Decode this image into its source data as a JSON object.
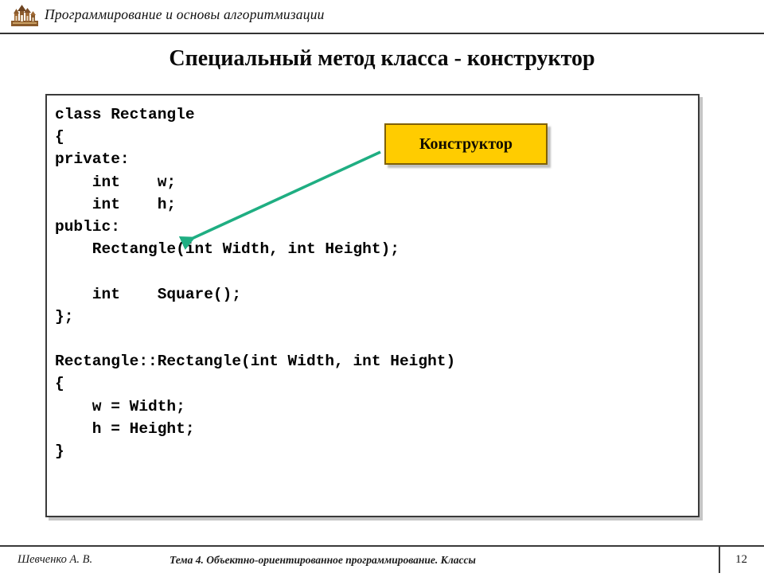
{
  "header": {
    "course_title": "Программирование и основы алгоритмизации",
    "logo_icon": "university-emblem-icon"
  },
  "slide": {
    "title": "Специальный метод класса - конструктор",
    "number": "12"
  },
  "code": {
    "language": "cpp",
    "text": "class Rectangle\n{\nprivate:\n    int    w;\n    int    h;\npublic:\n    Rectangle(int Width, int Height);\n\n    int    Square();\n};\n\nRectangle::Rectangle(int Width, int Height)\n{\n    w = Width;\n    h = Height;\n}",
    "lines": [
      "class Rectangle",
      "{",
      "private:",
      "    int    w;",
      "    int    h;",
      "public:",
      "    Rectangle(int Width, int Height);",
      "",
      "    int    Square();",
      "};",
      "",
      "Rectangle::Rectangle(int Width, int Height)",
      "{",
      "    w = Width;",
      "    h = Height;",
      "}"
    ]
  },
  "callout": {
    "label": "Конструктор",
    "fill_color": "#FFCC00",
    "border_color": "#7F6000",
    "arrow_color": "#1FAE82",
    "arrow_icon": "arrow-pointer-icon",
    "points_to": "Rectangle(int Width, int Height);"
  },
  "footer": {
    "author": "Шевченко А. В.",
    "topic": "Тема 4. Объектно-ориентированное программирование. Классы",
    "page": "12"
  }
}
